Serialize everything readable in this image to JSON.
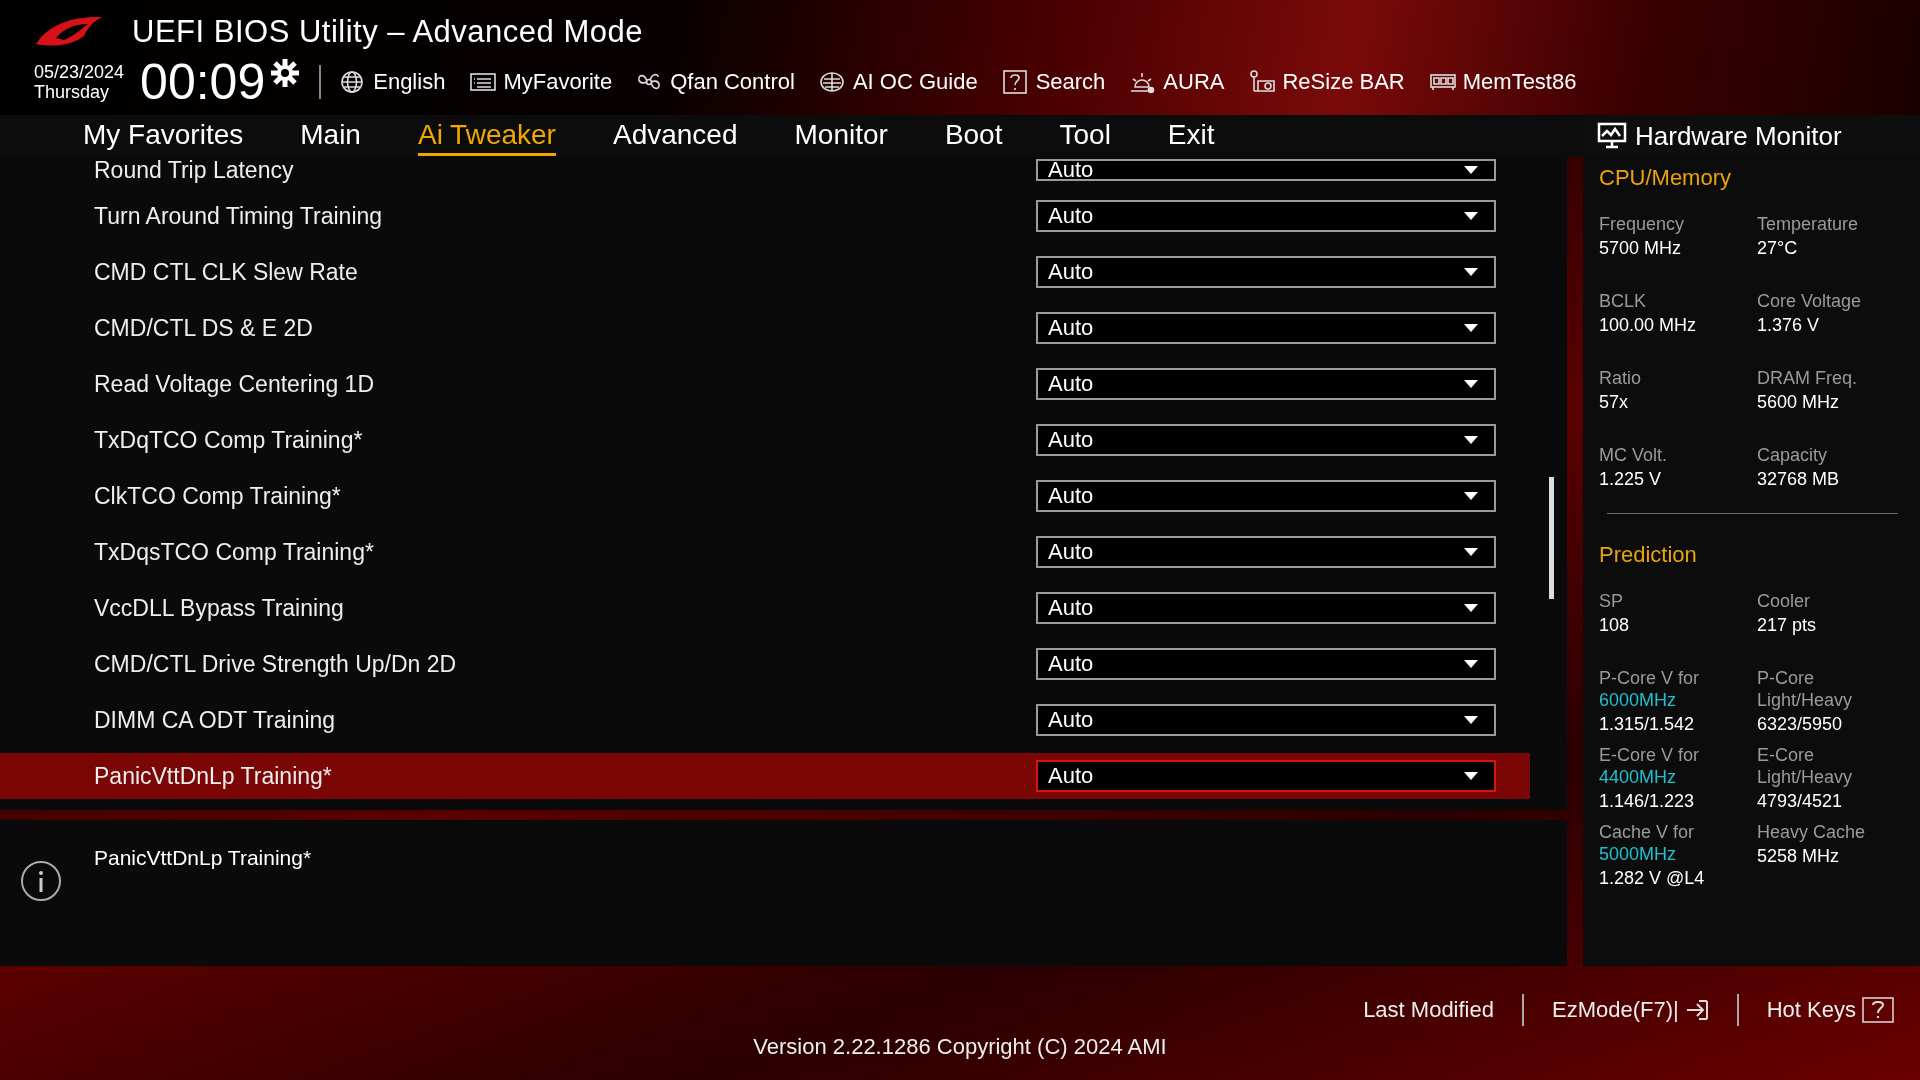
{
  "header": {
    "title": "UEFI BIOS Utility – Advanced Mode",
    "date": "05/23/2024",
    "weekday": "Thursday",
    "time": "00:09",
    "tools": [
      {
        "label": "English"
      },
      {
        "label": "MyFavorite"
      },
      {
        "label": "Qfan Control"
      },
      {
        "label": "AI OC Guide"
      },
      {
        "label": "Search"
      },
      {
        "label": "AURA"
      },
      {
        "label": "ReSize BAR"
      },
      {
        "label": "MemTest86"
      }
    ]
  },
  "tabs": [
    {
      "label": "My Favorites",
      "selected": false
    },
    {
      "label": "Main",
      "selected": false
    },
    {
      "label": "Ai Tweaker",
      "selected": true
    },
    {
      "label": "Advanced",
      "selected": false
    },
    {
      "label": "Monitor",
      "selected": false
    },
    {
      "label": "Boot",
      "selected": false
    },
    {
      "label": "Tool",
      "selected": false
    },
    {
      "label": "Exit",
      "selected": false
    }
  ],
  "settings": [
    {
      "label": "Round Trip Latency",
      "value": "Auto",
      "selected": false
    },
    {
      "label": "Turn Around Timing Training",
      "value": "Auto",
      "selected": false
    },
    {
      "label": "CMD CTL CLK Slew Rate",
      "value": "Auto",
      "selected": false
    },
    {
      "label": "CMD/CTL DS & E 2D",
      "value": "Auto",
      "selected": false
    },
    {
      "label": "Read Voltage Centering 1D",
      "value": "Auto",
      "selected": false
    },
    {
      "label": "TxDqTCO Comp Training*",
      "value": "Auto",
      "selected": false
    },
    {
      "label": "ClkTCO Comp Training*",
      "value": "Auto",
      "selected": false
    },
    {
      "label": "TxDqsTCO Comp Training*",
      "value": "Auto",
      "selected": false
    },
    {
      "label": "VccDLL Bypass Training",
      "value": "Auto",
      "selected": false
    },
    {
      "label": "CMD/CTL Drive Strength Up/Dn 2D",
      "value": "Auto",
      "selected": false
    },
    {
      "label": "DIMM CA ODT Training",
      "value": "Auto",
      "selected": false
    },
    {
      "label": "PanicVttDnLp Training*",
      "value": "Auto",
      "selected": true
    }
  ],
  "help": {
    "text": "PanicVttDnLp Training*"
  },
  "hardware_monitor": {
    "title": "Hardware Monitor",
    "sections": [
      {
        "title": "CPU/Memory",
        "items": [
          {
            "label": "Frequency",
            "value": "5700 MHz"
          },
          {
            "label": "Temperature",
            "value": "27°C"
          },
          {
            "label": "BCLK",
            "value": "100.00 MHz"
          },
          {
            "label": "Core Voltage",
            "value": "1.376 V"
          },
          {
            "label": "Ratio",
            "value": "57x"
          },
          {
            "label": "DRAM Freq.",
            "value": "5600 MHz"
          },
          {
            "label": "MC Volt.",
            "value": "1.225 V"
          },
          {
            "label": "Capacity",
            "value": "32768 MB"
          }
        ]
      },
      {
        "title": "Prediction",
        "items": [
          {
            "label": "SP",
            "value": "108"
          },
          {
            "label": "Cooler",
            "value": "217 pts"
          },
          {
            "label": "P-Core V for",
            "sublabel": "6000MHz",
            "value": "1.315/1.542"
          },
          {
            "label": "P-Core Light/Heavy",
            "value": "6323/5950"
          },
          {
            "label": "E-Core V for",
            "sublabel": "4400MHz",
            "value": "1.146/1.223"
          },
          {
            "label": "E-Core Light/Heavy",
            "value": "4793/4521"
          },
          {
            "label": "Cache V for",
            "sublabel": "5000MHz",
            "value": "1.282 V @L4"
          },
          {
            "label": "Heavy Cache",
            "value": "5258 MHz"
          }
        ]
      }
    ]
  },
  "footer": {
    "actions": [
      {
        "label": "Last Modified"
      },
      {
        "label": "EzMode(F7)|"
      },
      {
        "label": "Hot Keys"
      }
    ],
    "version": "Version 2.22.1286 Copyright (C) 2024 AMI"
  }
}
